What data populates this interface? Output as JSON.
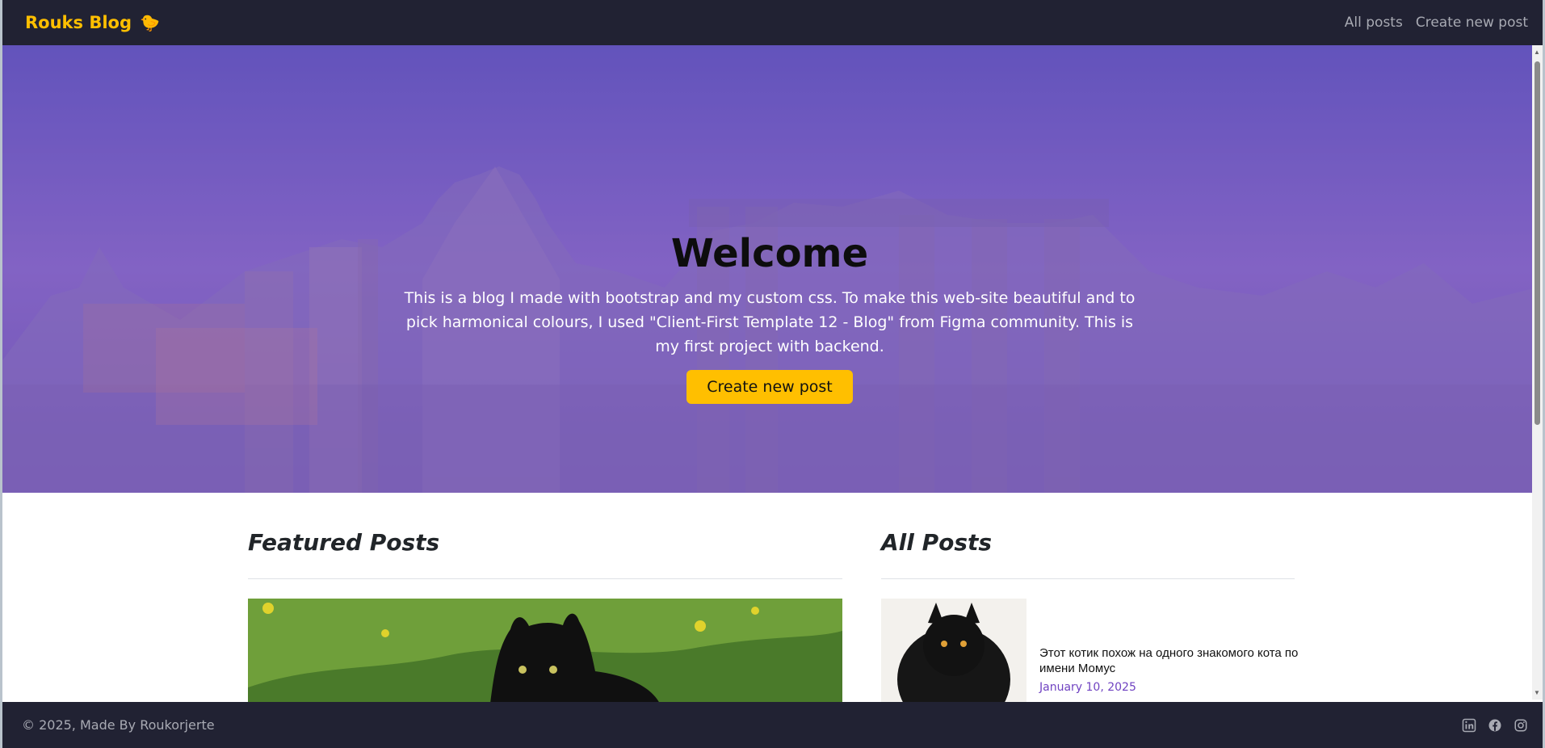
{
  "navbar": {
    "brand": "Rouks Blog",
    "brand_icon": "chick-icon",
    "links": [
      "All posts",
      "Create new post"
    ]
  },
  "hero": {
    "title": "Welcome",
    "description": "This is a blog I made with bootstrap and my custom css. To make this web-site beautiful and to pick harmonical colours, I used \"Client-First Template 12 - Blog\" from Figma community. This is my first project with backend.",
    "button": "Create new post"
  },
  "sections": {
    "featured_title": "Featured Posts",
    "all_title": "All Posts"
  },
  "posts": [
    {
      "title": "Этот котик похож на одного знакомого кота по имени Момус",
      "date": "January 10, 2025"
    }
  ],
  "footer": {
    "copyright": "© 2025, Made By Roukorjerte",
    "social_icons": [
      "linkedin-icon",
      "facebook-icon",
      "instagram-icon"
    ]
  },
  "colors": {
    "navbar": "#212233",
    "accent": "#ffbf00",
    "date": "#6f42c1",
    "hero_overlay": "#6e50c8"
  }
}
